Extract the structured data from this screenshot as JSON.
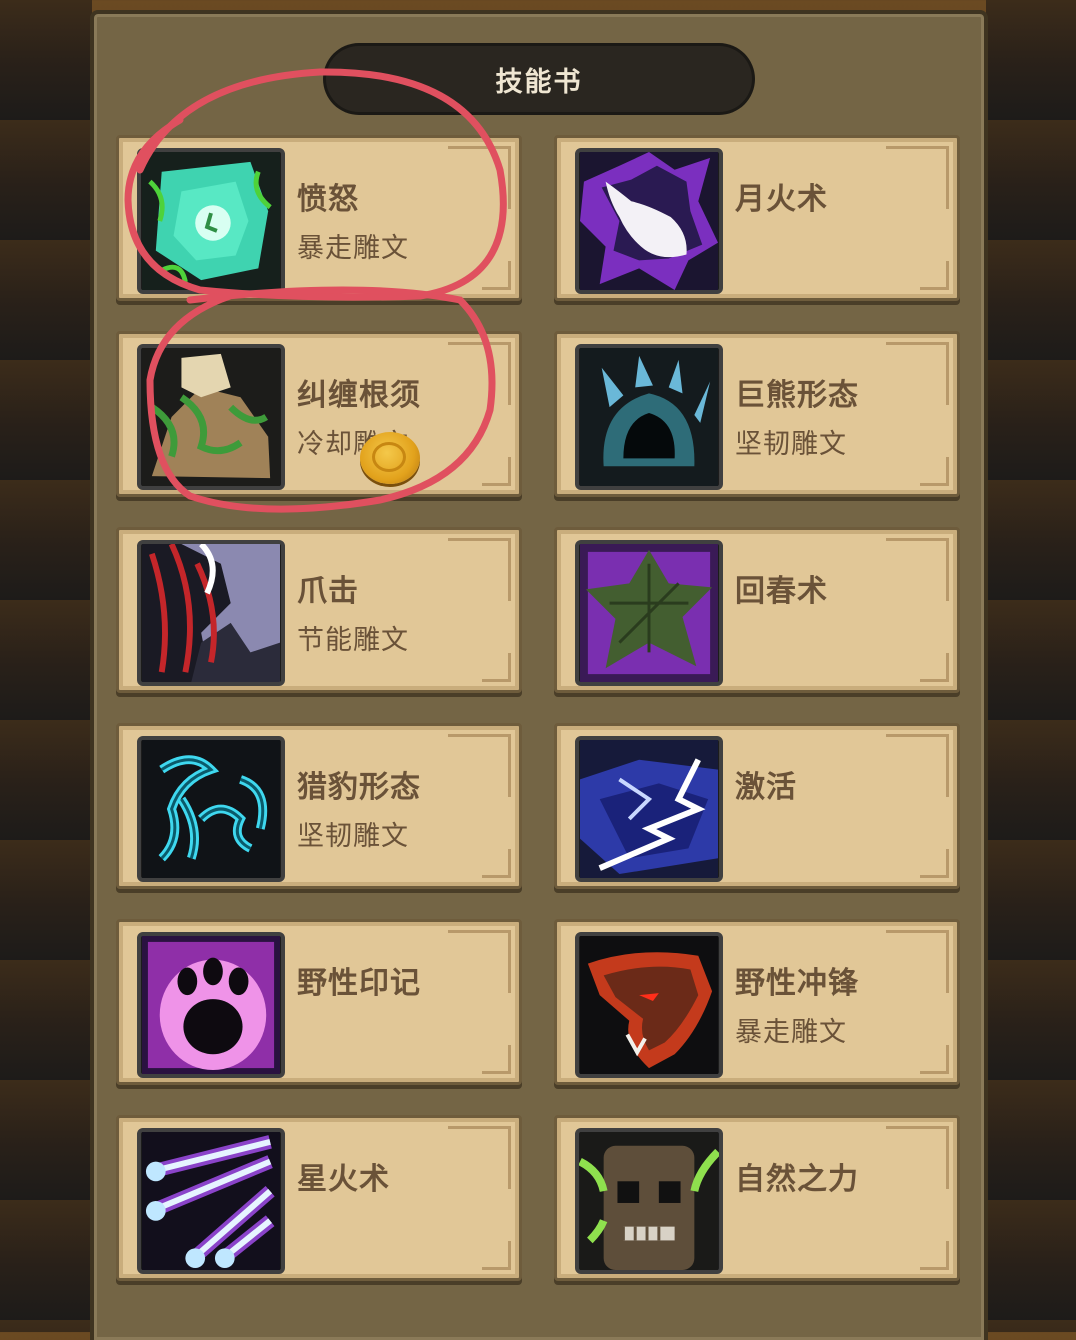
{
  "title": "技能书",
  "skills": [
    {
      "name": "愤怒",
      "glyph": "暴走雕文",
      "icon": "rage-icon"
    },
    {
      "name": "月火术",
      "glyph": "",
      "icon": "moonfire-icon"
    },
    {
      "name": "纠缠根须",
      "glyph": "冷却雕文",
      "icon": "entangling-roots-icon"
    },
    {
      "name": "巨熊形态",
      "glyph": "坚韧雕文",
      "icon": "bear-form-icon"
    },
    {
      "name": "爪击",
      "glyph": "节能雕文",
      "icon": "claw-icon"
    },
    {
      "name": "回春术",
      "glyph": "",
      "icon": "rejuvenation-icon"
    },
    {
      "name": "猎豹形态",
      "glyph": "坚韧雕文",
      "icon": "cat-form-icon"
    },
    {
      "name": "激活",
      "glyph": "",
      "icon": "innervate-icon"
    },
    {
      "name": "野性印记",
      "glyph": "",
      "icon": "mark-of-the-wild-icon"
    },
    {
      "name": "野性冲锋",
      "glyph": "暴走雕文",
      "icon": "wild-charge-icon"
    },
    {
      "name": "星火术",
      "glyph": "",
      "icon": "starfire-icon"
    },
    {
      "name": "自然之力",
      "glyph": "",
      "icon": "force-of-nature-icon"
    }
  ],
  "colors": {
    "card": "#e1c797",
    "panel": "#746545",
    "text": "#6a5238",
    "annotation": "#e0505f"
  }
}
